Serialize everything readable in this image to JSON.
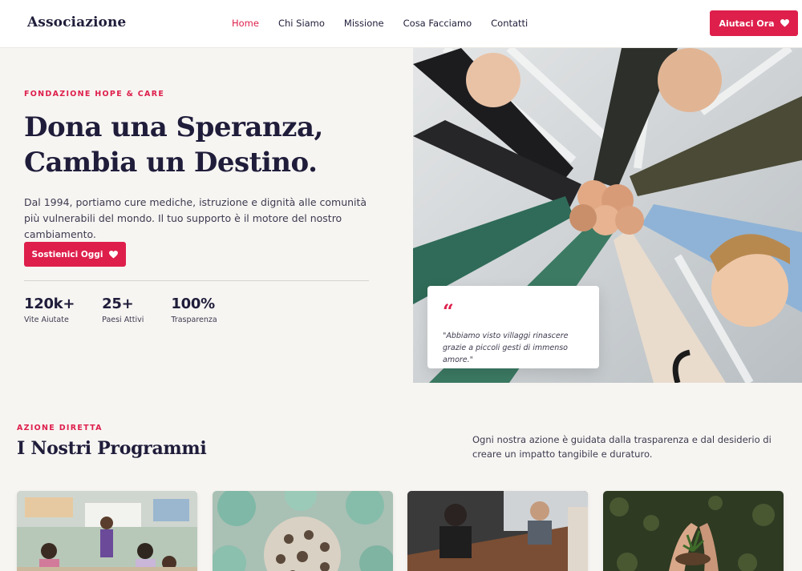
{
  "nav": {
    "logo": "Associazione",
    "links": [
      "Home",
      "Chi Siamo",
      "Missione",
      "Cosa Facciamo",
      "Contatti"
    ],
    "active": "Home",
    "cta_label": "Aiutaci Ora"
  },
  "hero": {
    "eyebrow": "FONDAZIONE HOPE & CARE",
    "title_line1": "Dona una Speranza,",
    "title_line2": "Cambia un Destino.",
    "description": "Dal 1994, portiamo cure mediche, istruzione e dignità alle comunità più vulnerabili del mondo. Il tuo supporto è il motore del nostro cambiamento.",
    "cta_label": "Sostienici Oggi",
    "stats": [
      {
        "value": "120k+",
        "label": "Vite Aiutate"
      },
      {
        "value": "25+",
        "label": "Paesi Attivi"
      },
      {
        "value": "100%",
        "label": "Trasparenza"
      }
    ],
    "quote_mark": "“",
    "quote": "\"Abbiamo visto villaggi rinascere grazie a piccoli gesti di immenso amore.\""
  },
  "programs": {
    "eyebrow": "AZIONE DIRETTA",
    "title": "I Nostri Programmi",
    "description": "Ogni nostra azione è guidata dalla trasparenza e dal desiderio di creare un impatto tangibile e duraturo."
  },
  "colors": {
    "accent": "#de1f4b",
    "navy": "#1f1d3a",
    "background": "#f7f5f2"
  },
  "icons": [
    "heart-icon",
    "quote-icon"
  ]
}
